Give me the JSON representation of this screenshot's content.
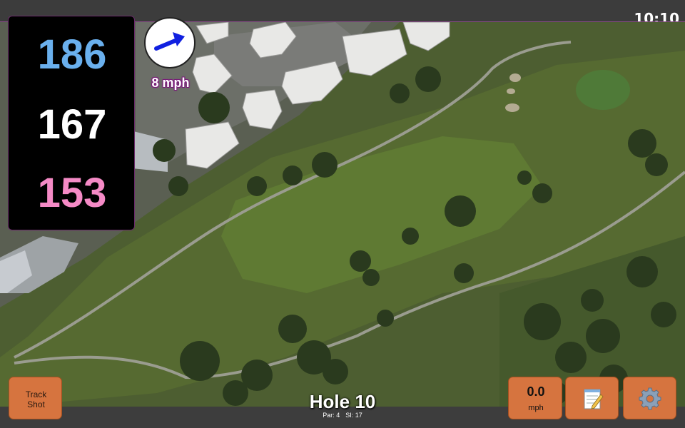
{
  "status": {
    "clock": "10:10"
  },
  "distances": {
    "back": "186",
    "middle": "167",
    "front": "153",
    "colors": {
      "back": "#6ab0ee",
      "middle": "#ffffff",
      "front": "#f58ac6"
    }
  },
  "wind": {
    "speed_label": "8 mph",
    "icon": "wind-arrow-icon",
    "arrow_color": "#1020e0"
  },
  "hole": {
    "title": "Hole 10",
    "par": "Par: 4",
    "si": "SI: 17"
  },
  "buttons": {
    "track_shot_line1": "Track",
    "track_shot_line2": "Shot",
    "speed_value": "0.0",
    "speed_unit": "mph",
    "notes_icon": "notepad-icon",
    "settings_icon": "gear-icon",
    "button_color": "#d6743f"
  }
}
